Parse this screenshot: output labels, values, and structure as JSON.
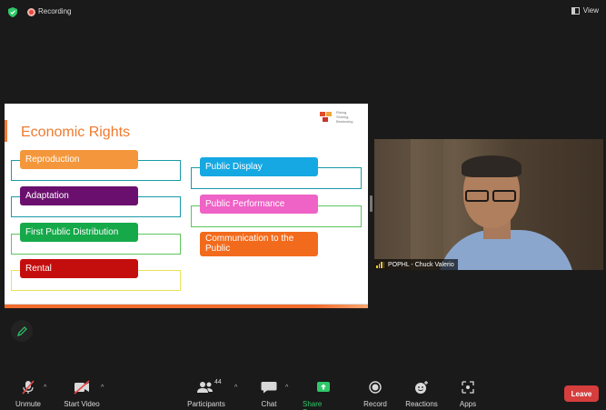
{
  "topbar": {
    "recording_label": "Recording",
    "view_label": "View"
  },
  "slide": {
    "title": "Economic Rights",
    "logo_lines": [
      "Rising,",
      "Shining,",
      "Bestowing"
    ],
    "left_items": [
      {
        "label": "Reproduction",
        "color": "#f4973c"
      },
      {
        "label": "Adaptation",
        "color": "#6b0f6e"
      },
      {
        "label": "First Public Distribution",
        "color": "#16a94a"
      },
      {
        "label": "Rental",
        "color": "#c40e0e"
      }
    ],
    "right_items": [
      {
        "label": "Public Display",
        "color": "#16a8e2"
      },
      {
        "label": "Public Performance",
        "color": "#ef62c6"
      },
      {
        "label": "Communication to the Public",
        "color": "#f26b1d"
      }
    ]
  },
  "video": {
    "participant_name": "POPHL - Chuck Valerio"
  },
  "toolbar": {
    "unmute": "Unmute",
    "start_video": "Start Video",
    "participants": "Participants",
    "participant_count": "44",
    "chat": "Chat",
    "share_screen": "Share Screen",
    "record": "Record",
    "reactions": "Reactions",
    "apps": "Apps",
    "leave": "Leave"
  },
  "colors": {
    "accent_green": "#2fc86a",
    "leave_red": "#d63d3d",
    "title_orange": "#ef7a2f"
  }
}
